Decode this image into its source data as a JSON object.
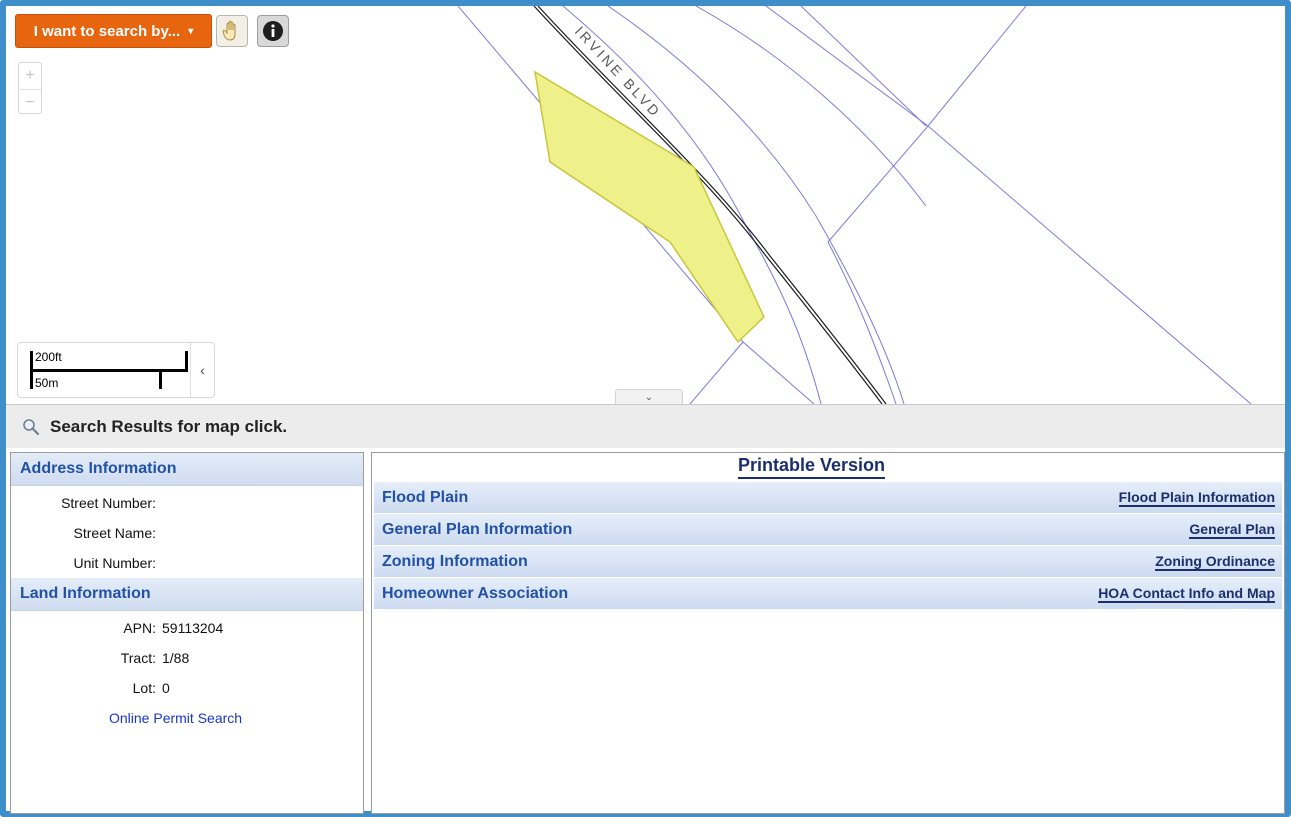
{
  "toolbar": {
    "search_by_label": "I want to search by...",
    "search_by_caret": "▾"
  },
  "map": {
    "zoom_in": "+",
    "zoom_out": "−",
    "scale_ft": "200ft",
    "scale_m": "50m",
    "scale_collapse": "‹",
    "panel_toggle": "⌄",
    "street_label": "IRVINE BLVD",
    "colors": {
      "parcel_lines": "#7b7bd8",
      "selected_parcel_fill": "#eef08a",
      "selected_parcel_stroke": "#c9c63b",
      "road_centerline": "#1a1a1a"
    }
  },
  "results": {
    "title": "Search Results for map click."
  },
  "address": {
    "header": "Address Information",
    "fields": [
      {
        "label": "Street Number:",
        "value": ""
      },
      {
        "label": "Street Name:",
        "value": ""
      },
      {
        "label": "Unit Number:",
        "value": ""
      }
    ]
  },
  "land": {
    "header": "Land Information",
    "fields": [
      {
        "label": "APN:",
        "value": "59113204"
      },
      {
        "label": "Tract:",
        "value": "1/88"
      },
      {
        "label": "Lot:",
        "value": "0"
      }
    ],
    "permit_link": "Online Permit Search"
  },
  "details": {
    "printable": "Printable Version",
    "rows": [
      {
        "title": "Flood Plain",
        "link": "Flood Plain Information"
      },
      {
        "title": "General Plan Information",
        "link": "General Plan"
      },
      {
        "title": "Zoning Information",
        "link": "Zoning Ordinance"
      },
      {
        "title": "Homeowner Association",
        "link": "HOA Contact Info and Map"
      }
    ]
  }
}
